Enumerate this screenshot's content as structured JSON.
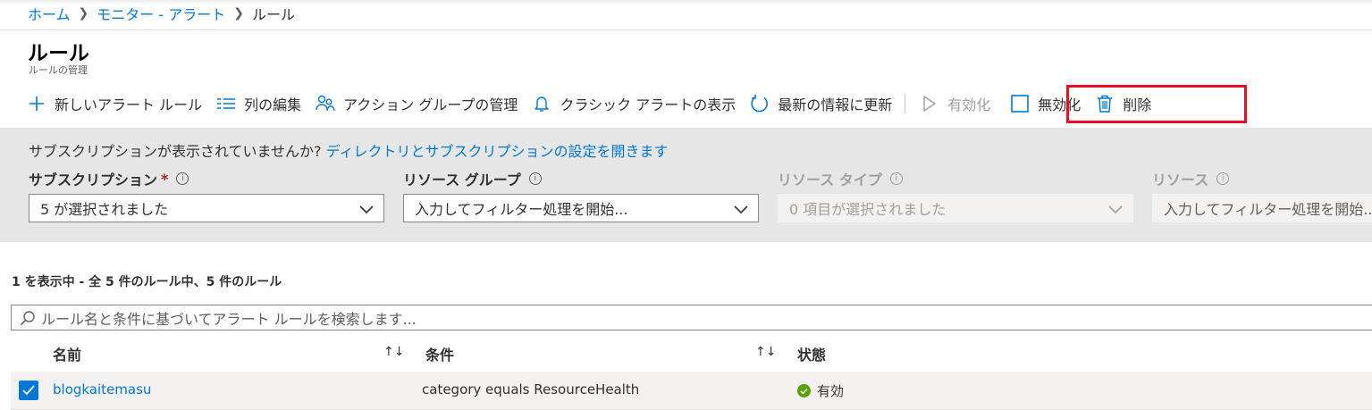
{
  "breadcrumb": {
    "items": [
      "ホーム",
      "モニター - アラート"
    ],
    "current": "ルール"
  },
  "page": {
    "title": "ルール",
    "subtitle": "ルールの管理"
  },
  "toolbar": {
    "new_rule": "新しいアラート ルール",
    "edit_columns": "列の編集",
    "manage_action_groups": "アクション グループの管理",
    "show_classic_alerts": "クラシック アラートの表示",
    "refresh": "最新の情報に更新",
    "enable": "有効化",
    "disable": "無効化",
    "delete": "削除"
  },
  "filters": {
    "notice_text": "サブスクリプションが表示されていませんか?",
    "notice_link": "ディレクトリとサブスクリプションの設定を開きます",
    "subscription": {
      "label": "サブスクリプション",
      "required_mark": "*",
      "value": "5 が選択されました"
    },
    "resource_group": {
      "label": "リソース グループ",
      "placeholder": "入力してフィルター処理を開始..."
    },
    "resource_type": {
      "label": "リソース タイプ",
      "value": "0 項目が選択されました"
    },
    "resource": {
      "label": "リソース",
      "placeholder": "入力してフィルター処理を開始..."
    }
  },
  "results": {
    "count_text": "1 を表示中 - 全 5 件のルール中、5 件のルール",
    "search_placeholder": "ルール名と条件に基づいてアラート ルールを検索します..."
  },
  "table": {
    "columns": [
      "名前",
      "条件",
      "状態"
    ],
    "rows": [
      {
        "name": "blogkaitemasu",
        "condition": "category equals ResourceHealth",
        "status": "有効",
        "selected": true
      }
    ]
  },
  "colors": {
    "accent": "#0078d4",
    "highlight_box": "#e81123",
    "status_enabled": "#57a300",
    "filter_panel": "#e6e6e6"
  },
  "icons": {
    "new_rule": "plus-icon",
    "edit_columns": "columns-icon",
    "manage_action_groups": "people-icon",
    "show_classic_alerts": "bell-icon",
    "refresh": "refresh-icon",
    "enable": "play-icon",
    "disable": "checkbox-empty-icon",
    "delete": "trash-icon",
    "search": "search-icon",
    "status": "check-circle-icon"
  }
}
